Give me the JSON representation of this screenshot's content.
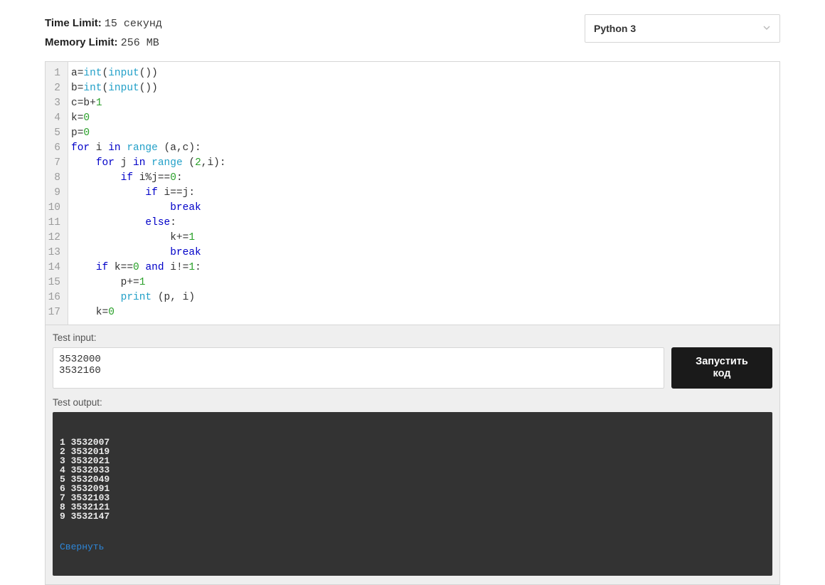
{
  "limits": {
    "time_label": "Time Limit:",
    "time_value": "15 секунд",
    "mem_label": "Memory Limit:",
    "mem_value": "256 MB"
  },
  "lang_select": {
    "selected": "Python 3"
  },
  "code": {
    "lines": [
      "a=int(input())",
      "b=int(input())",
      "c=b+1",
      "k=0",
      "p=0",
      "for i in range (a,c):",
      "    for j in range (2,i):",
      "        if i%j==0:",
      "            if i==j:",
      "                break",
      "            else:",
      "                k+=1",
      "                break",
      "    if k==0 and i!=1:",
      "        p+=1",
      "        print (p, i)",
      "    k=0"
    ],
    "line_numbers": [
      "1",
      "2",
      "3",
      "4",
      "5",
      "6",
      "7",
      "8",
      "9",
      "10",
      "11",
      "12",
      "13",
      "14",
      "15",
      "16",
      "17"
    ]
  },
  "test": {
    "input_label": "Test input:",
    "input_value": "3532000\n3532160",
    "run_label": "Запустить\nкод",
    "output_label": "Test output:",
    "output_value": "1 3532007\n2 3532019\n3 3532021\n4 3532033\n5 3532049\n6 3532091\n7 3532103\n8 3532121\n9 3532147",
    "collapse": "Свернуть"
  }
}
